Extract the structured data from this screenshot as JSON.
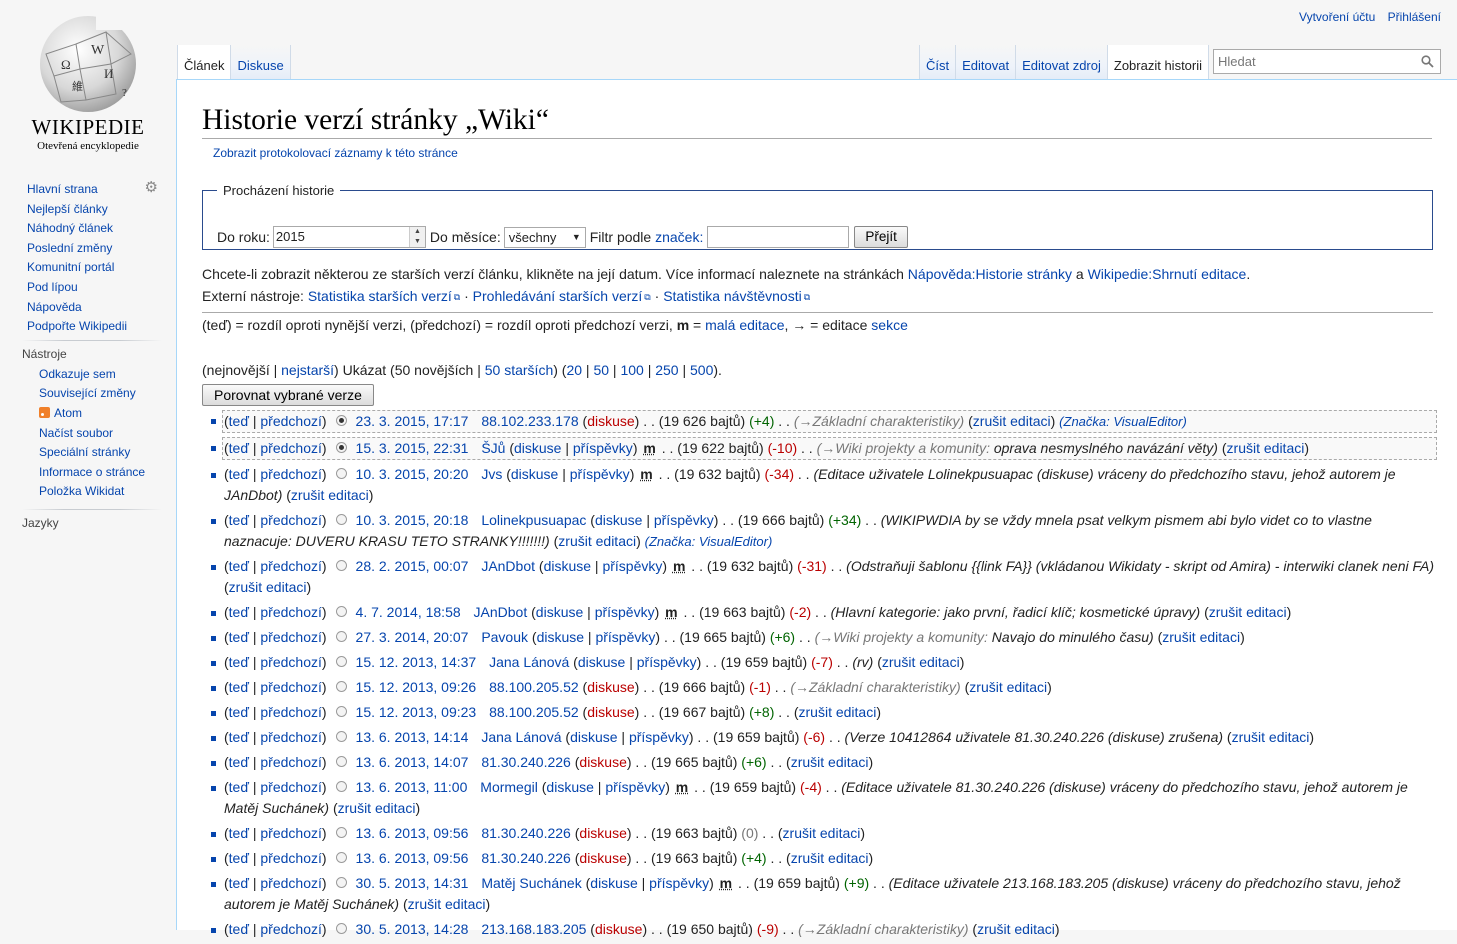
{
  "personal": {
    "create_account": "Vytvoření účtu",
    "login": "Přihlášení"
  },
  "logo": {
    "wordmark": "WIKIPEDIE",
    "tagline": "Otevřená encyklopedie"
  },
  "sidebar": {
    "nav": [
      "Hlavní strana",
      "Nejlepší články",
      "Náhodný článek",
      "Poslední změny",
      "Komunitní portál",
      "Pod lípou",
      "Nápověda",
      "Podpořte Wikipedii"
    ],
    "tools_title": "Nástroje",
    "tools": [
      "Odkazuje sem",
      "Související změny",
      "Atom",
      "Načíst soubor",
      "Speciální stránky",
      "Informace o stránce",
      "Položka Wikidat"
    ],
    "languages_title": "Jazyky"
  },
  "tabs": {
    "article": "Článek",
    "talk": "Diskuse",
    "read": "Číst",
    "edit": "Editovat",
    "edit_source": "Editovat zdroj",
    "history": "Zobrazit historii"
  },
  "search": {
    "placeholder": "Hledat"
  },
  "page": {
    "title": "Historie verzí stránky „Wiki“",
    "logs_link": "Zobrazit protokolovací záznamy k této stránce"
  },
  "browse": {
    "legend": "Procházení historie",
    "year_label": "Do roku:",
    "year_value": "2015",
    "month_label": "Do měsíce:",
    "month_value": "všechny",
    "tag_label": "Filtr podle",
    "tag_link": "značek",
    "tag_colon": ":",
    "go": "Přejít"
  },
  "info": {
    "line1": "Chcete-li zobrazit některou ze starších verzí článku, klikněte na její datum. Více informací naleznete na stránkách ",
    "help_link": "Nápověda:Historie stránky",
    "and": " a ",
    "summary_link": "Wikipedie:Shrnutí editace",
    "period": ".",
    "ext_label": "Externí nástroje: ",
    "ext1": "Statistika starších verzí",
    "ext2": "Prohledávání starších verzí",
    "ext3": "Statistika návštěvnosti",
    "dot": " · ",
    "legend_text1": "(teď) = rozdíl oproti nynější verzi, (předchozí) = rozdíl oproti předchozí verzi,  ",
    "legend_m": "m",
    "legend_eq": " = ",
    "legend_minor": "malá editace",
    "legend_text2": ", → = editace ",
    "legend_section": "sekce"
  },
  "paging": {
    "pre": "(nejnovější | ",
    "oldest": "nejstarší",
    "show": ") Ukázat (50 novějších | ",
    "older": "50 starších",
    "mid": ") (",
    "n20": "20",
    "n50": "50",
    "n100": "100",
    "n250": "250",
    "n500": "500",
    "sep": " | ",
    "end": ")."
  },
  "compare_button": "Porovnat vybrané verze",
  "history": [
    {
      "date": "23. 3. 2015, 17:17",
      "user": "88.102.233.178",
      "user_links": [
        "diskuse"
      ],
      "minor": false,
      "size": "(19 626 bajtů)",
      "diff": "(+4)",
      "diff_class": "grn",
      "comment_gray": "(→Základní charakteristiky)",
      "comment": "",
      "trail": "zrušit editaci",
      "tag": "(Značka: VisualEditor)",
      "radio": "on",
      "selected": true
    },
    {
      "date": "15. 3. 2015, 22:31",
      "user": "ŠJů",
      "user_links": [
        "diskuse",
        "příspěvky"
      ],
      "minor": true,
      "size": "(19 622 bajtů)",
      "diff": "(-10)",
      "diff_class": "red",
      "comment_gray": "(→Wiki projekty a komunity:",
      "comment": " oprava nesmysl­ného navázání věty)",
      "trail": "zrušit editaci",
      "tag": "",
      "radio": "on",
      "selected": true
    },
    {
      "date": "10. 3. 2015, 20:20",
      "user": "Jvs",
      "user_links": [
        "diskuse",
        "příspěvky"
      ],
      "minor": true,
      "size": "(19 632 bajtů)",
      "diff": "(-34)",
      "diff_class": "red",
      "comment_gray": "",
      "comment": "(Editace uživatele Lolinekpusuapac (diskuse) vráceny do předchozího stavu, jehož autorem je JAnDbot)",
      "trail": "zrušit editaci",
      "tag": "",
      "radio": "off",
      "selected": false
    },
    {
      "date": "10. 3. 2015, 20:18",
      "user": "Lolinekpusuapac",
      "user_links": [
        "diskuse",
        "příspěvky"
      ],
      "minor": false,
      "size": "(19 666 bajtů)",
      "diff": "(+34)",
      "diff_class": "grn",
      "comment_gray": "",
      "comment": "(WIKIPWDIA by se vždy mnela psat velkym pismem abi bylo videt co to vlastne naznacuje: DUVERU KRASU TETO STRANKY!!!!!!!)",
      "trail": "zrušit editaci",
      "tag": "(Značka: VisualEditor)",
      "radio": "off",
      "selected": false
    },
    {
      "date": "28. 2. 2015, 00:07",
      "user": "JAnDbot",
      "user_links": [
        "diskuse",
        "příspěvky"
      ],
      "minor": true,
      "size": "(19 632 bajtů)",
      "diff": "(-31)",
      "diff_class": "red",
      "comment_gray": "",
      "comment": "(Odstraňuji šablonu {{link FA}} (vkládanou Wikidaty - skript od Amira) - interwiki clanek neni FA)",
      "trail": "zrušit editaci",
      "tag": "",
      "radio": "off",
      "selected": false
    },
    {
      "date": "4. 7. 2014, 18:58",
      "user": "JAnDbot",
      "user_links": [
        "diskuse",
        "příspěvky"
      ],
      "minor": true,
      "size": "(19 663 bajtů)",
      "diff": "(-2)",
      "diff_class": "red",
      "comment_gray": "",
      "comment": "(Hlavní kategorie: jako první, řadicí klíč; kosmetické úpravy)",
      "trail": "zrušit editaci",
      "tag": "",
      "radio": "off",
      "selected": false
    },
    {
      "date": "27. 3. 2014, 20:07",
      "user": "Pavouk",
      "user_links": [
        "diskuse",
        "příspěvky"
      ],
      "minor": false,
      "size": "(19 665 bajtů)",
      "diff": "(+6)",
      "diff_class": "grn",
      "comment_gray": "(→Wiki projekty a komunity:",
      "comment": " Navajo do minulého času)",
      "trail": "zrušit editaci",
      "tag": "",
      "radio": "off",
      "selected": false
    },
    {
      "date": "15. 12. 2013, 14:37",
      "user": "Jana Lánová",
      "user_links": [
        "diskuse",
        "příspěvky"
      ],
      "minor": false,
      "size": "(19 659 bajtů)",
      "diff": "(-7)",
      "diff_class": "red",
      "comment_gray": "",
      "comment": "(rv)",
      "trail": "zrušit editaci",
      "tag": "",
      "radio": "off",
      "selected": false
    },
    {
      "date": "15. 12. 2013, 09:26",
      "user": "88.100.205.52",
      "user_links": [
        "diskuse"
      ],
      "minor": false,
      "size": "(19 666 bajtů)",
      "diff": "(-1)",
      "diff_class": "red",
      "comment_gray": "(→Základní charakteristiky)",
      "comment": "",
      "trail": "zrušit editaci",
      "tag": "",
      "radio": "off",
      "selected": false
    },
    {
      "date": "15. 12. 2013, 09:23",
      "user": "88.100.205.52",
      "user_links": [
        "diskuse"
      ],
      "minor": false,
      "size": "(19 667 bajtů)",
      "diff": "(+8)",
      "diff_class": "grn",
      "comment_gray": "",
      "comment": "",
      "trail": "zrušit editaci",
      "tag": "",
      "radio": "off",
      "selected": false
    },
    {
      "date": "13. 6. 2013, 14:14",
      "user": "Jana Lánová",
      "user_links": [
        "diskuse",
        "příspěvky"
      ],
      "minor": false,
      "size": "(19 659 bajtů)",
      "diff": "(-6)",
      "diff_class": "red",
      "comment_gray": "",
      "comment": "(Verze 10412864 uživatele 81.30.240.226 (diskuse) zrušena)",
      "trail": "zrušit editaci",
      "tag": "",
      "radio": "off",
      "selected": false
    },
    {
      "date": "13. 6. 2013, 14:07",
      "user": "81.30.240.226",
      "user_links": [
        "diskuse"
      ],
      "minor": false,
      "size": "(19 665 bajtů)",
      "diff": "(+6)",
      "diff_class": "grn",
      "comment_gray": "",
      "comment": "",
      "trail": "zrušit editaci",
      "tag": "",
      "radio": "off",
      "selected": false
    },
    {
      "date": "13. 6. 2013, 11:00",
      "user": "Mormegil",
      "user_links": [
        "diskuse",
        "příspěvky"
      ],
      "minor": true,
      "size": "(19 659 bajtů)",
      "diff": "(-4)",
      "diff_class": "red",
      "comment_gray": "",
      "comment": "(Editace uživatele 81.30.240.226 (diskuse) vráceny do předchozího stavu, jehož autorem je Matěj Suchánek)",
      "trail": "zrušit editaci",
      "tag": "",
      "radio": "off",
      "selected": false
    },
    {
      "date": "13. 6. 2013, 09:56",
      "user": "81.30.240.226",
      "user_links": [
        "diskuse"
      ],
      "minor": false,
      "size": "(19 663 bajtů)",
      "diff": "(0)",
      "diff_class": "gray",
      "comment_gray": "",
      "comment": "",
      "trail": "zrušit editaci",
      "tag": "",
      "radio": "off",
      "selected": false
    },
    {
      "date": "13. 6. 2013, 09:56",
      "user": "81.30.240.226",
      "user_links": [
        "diskuse"
      ],
      "minor": false,
      "size": "(19 663 bajtů)",
      "diff": "(+4)",
      "diff_class": "grn",
      "comment_gray": "",
      "comment": "",
      "trail": "zrušit editaci",
      "tag": "",
      "radio": "off",
      "selected": false
    },
    {
      "date": "30. 5. 2013, 14:31",
      "user": "Matěj Suchánek",
      "user_links": [
        "diskuse",
        "příspěvky"
      ],
      "minor": true,
      "size": "(19 659 bajtů)",
      "diff": "(+9)",
      "diff_class": "grn",
      "comment_gray": "",
      "comment": "(Editace uživatele 213.168.183.205 (diskuse) vráceny do předchozího stavu, jehož autorem je Matěj Suchánek)",
      "trail": "zrušit editaci",
      "tag": "",
      "radio": "off",
      "selected": false
    },
    {
      "date": "30. 5. 2013, 14:28",
      "user": "213.168.183.205",
      "user_links": [
        "diskuse"
      ],
      "minor": false,
      "size": "(19 650 bajtů)",
      "diff": "(-9)",
      "diff_class": "red",
      "comment_gray": "(→Základní charakteristiky)",
      "comment": "",
      "trail": "zrušit editaci",
      "tag": "",
      "radio": "off",
      "selected": false
    }
  ],
  "row_words": {
    "cur": "teď",
    "prev": "předchozí",
    "m": "m"
  }
}
